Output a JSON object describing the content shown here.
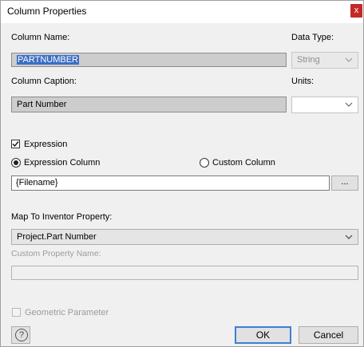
{
  "window": {
    "title": "Column Properties",
    "close_glyph": "x"
  },
  "column_name": {
    "label": "Column Name:",
    "value": "PARTNUMBER"
  },
  "data_type": {
    "label": "Data Type:",
    "value": "String"
  },
  "column_caption": {
    "label": "Column Caption:",
    "value": "Part Number"
  },
  "units": {
    "label": "Units:",
    "value": ""
  },
  "expression": {
    "checkbox_label": "Expression",
    "checked": true,
    "radio_expression_label": "Expression Column",
    "radio_custom_label": "Custom Column",
    "selected_radio": "expression-column",
    "value": "{Filename}",
    "browse_label": "..."
  },
  "map_property": {
    "label": "Map To Inventor Property:",
    "value": "Project.Part Number"
  },
  "custom_property": {
    "label": "Custom Property Name:",
    "value": ""
  },
  "geometric_parameter": {
    "label": "Geometric Parameter",
    "checked": false
  },
  "buttons": {
    "ok": "OK",
    "cancel": "Cancel",
    "help_glyph": "?"
  },
  "icons": {
    "close": "close-icon",
    "chevron": "chevron-down-icon",
    "help": "help-icon",
    "check": "checkmark-icon"
  }
}
